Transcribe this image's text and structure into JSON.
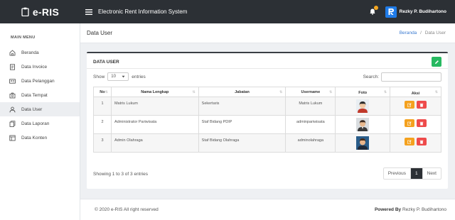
{
  "brand": {
    "title": "e-RIS",
    "icon": "clipboard-icon"
  },
  "header": {
    "app_title": "Electronic Rent Information System",
    "user_name": "Rezky P. Budihartono",
    "bell_badge_color": "#f4a620"
  },
  "sidebar": {
    "header": "MAIN MENU",
    "items": [
      {
        "label": "Beranda",
        "icon": "home-icon"
      },
      {
        "label": "Data Invoice",
        "icon": "invoice-icon"
      },
      {
        "label": "Data Pelanggan",
        "icon": "id-card-icon"
      },
      {
        "label": "Data Tempat",
        "icon": "building-icon"
      },
      {
        "label": "Data User",
        "icon": "user-icon",
        "active": true
      },
      {
        "label": "Data Laporan",
        "icon": "report-icon"
      },
      {
        "label": "Data Konten",
        "icon": "content-icon"
      }
    ]
  },
  "page": {
    "title": "Data User",
    "breadcrumb": [
      "Beranda",
      "Data User"
    ],
    "breadcrumb_sep": "/"
  },
  "card": {
    "title": "DATA USER",
    "show_label": "Show",
    "entries_value": "10",
    "entries_label": "entries",
    "search_label": "Search:",
    "columns": [
      "No",
      "Nama Lengkap",
      "Jabatan",
      "Username",
      "Foto",
      "Aksi"
    ],
    "rows": [
      {
        "no": "1",
        "nama": "Matris Lukum",
        "jabatan": "Sekertaris",
        "username": "Matris Lukum"
      },
      {
        "no": "2",
        "nama": "Administrator Pariwisata",
        "jabatan": "Staf Bidang PDIP",
        "username": "adminpariwisata"
      },
      {
        "no": "3",
        "nama": "Admin Olahraga",
        "jabatan": "Staf Bidang Olahraga",
        "username": "adminolahraga"
      }
    ],
    "info": "Showing 1 to 3 of 3 entries",
    "pager": {
      "prev": "Previous",
      "current": "1",
      "next": "Next"
    }
  },
  "footer": {
    "copyright": "© 2020 e-RIS All right reserved",
    "powered_label": "Powered By",
    "powered_name": "Rezky P. Budihartono"
  },
  "colors": {
    "accent": "#2c3035",
    "add_button": "#27b961",
    "edit_button": "#f4a11e",
    "delete_button": "#ee4b4b",
    "link": "#3b7bd1"
  }
}
